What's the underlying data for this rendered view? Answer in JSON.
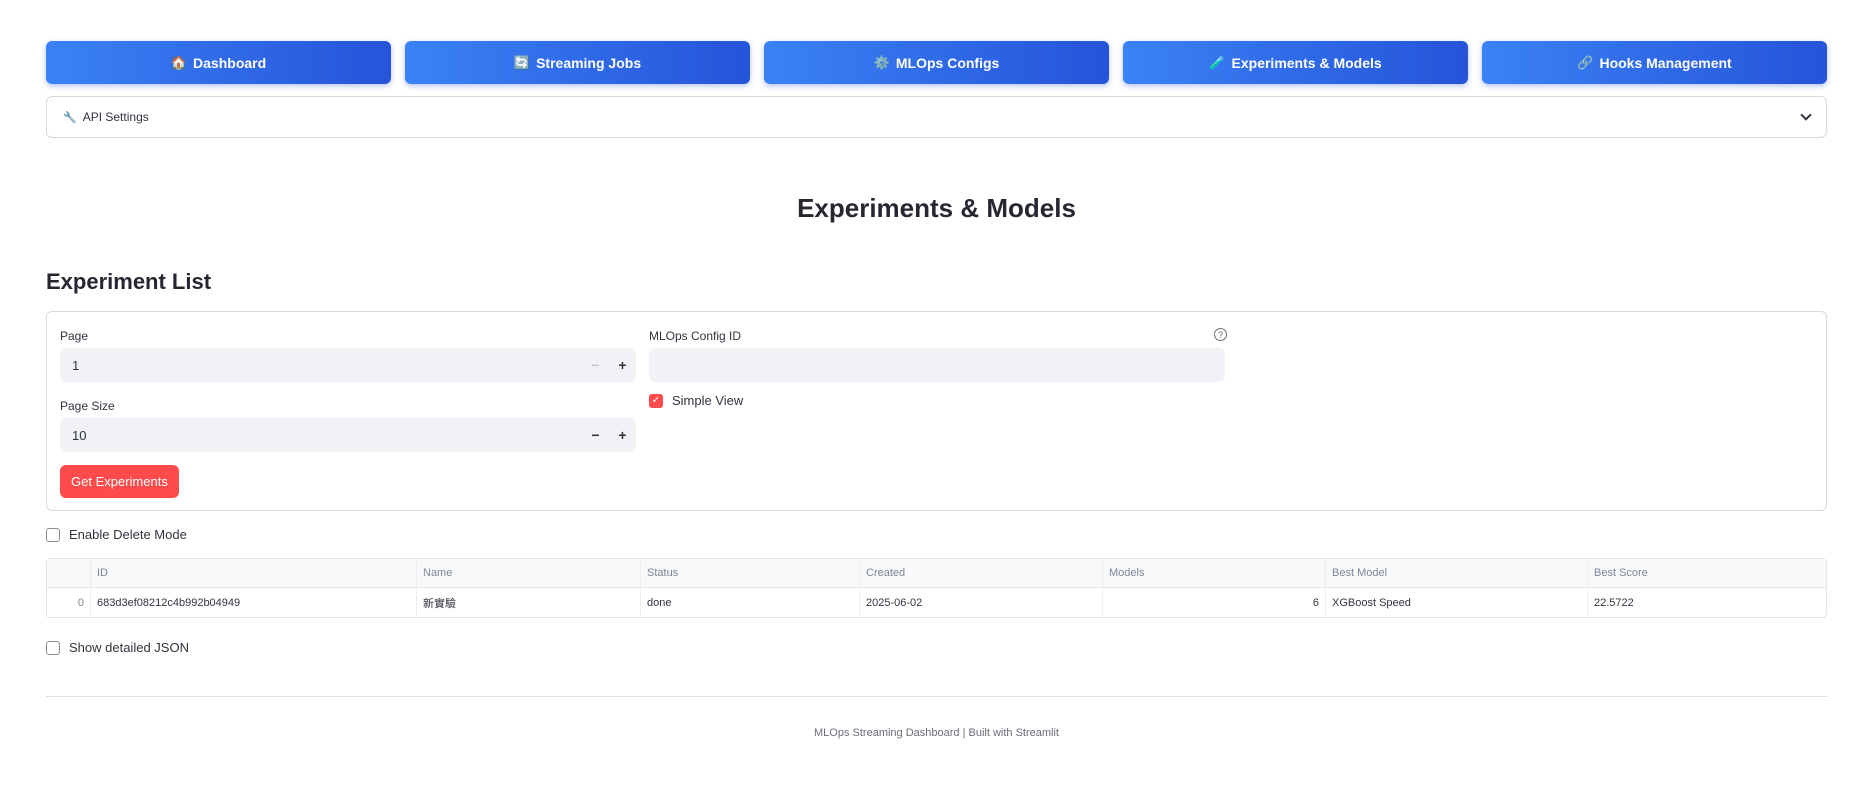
{
  "nav": [
    {
      "icon": "🏠",
      "label": "Dashboard"
    },
    {
      "icon": "🔄",
      "label": "Streaming Jobs"
    },
    {
      "icon": "⚙️",
      "label": "MLOps Configs"
    },
    {
      "icon": "🧪",
      "label": "Experiments & Models"
    },
    {
      "icon": "🔗",
      "label": "Hooks Management"
    }
  ],
  "api_settings": {
    "icon": "🔧",
    "label": "API Settings"
  },
  "page_title": "Experiments & Models",
  "section_title": "Experiment List",
  "form": {
    "page_label": "Page",
    "page_value": "1",
    "page_size_label": "Page Size",
    "page_size_value": "10",
    "config_id_label": "MLOps Config ID",
    "config_id_value": "",
    "simple_view_label": "Simple View",
    "simple_view_checked": true,
    "submit_label": "Get Experiments",
    "minus": "−",
    "plus": "+",
    "help": "?"
  },
  "delete_mode_label": "Enable Delete Mode",
  "table": {
    "columns": [
      "",
      "ID",
      "Name",
      "Status",
      "Created",
      "Models",
      "Best Model",
      "Best Score"
    ],
    "rows": [
      [
        "0",
        "683d3ef08212c4b992b04949",
        "新實驗",
        "done",
        "2025-06-02",
        "6",
        "XGBoost Speed",
        "22.5722"
      ]
    ]
  },
  "show_json_label": "Show detailed JSON",
  "footer": "MLOps Streaming Dashboard | Built with Streamlit",
  "colors": {
    "primary": "#ff4b4b",
    "nav_start": "#3b82f6",
    "nav_end": "#2554d9"
  }
}
